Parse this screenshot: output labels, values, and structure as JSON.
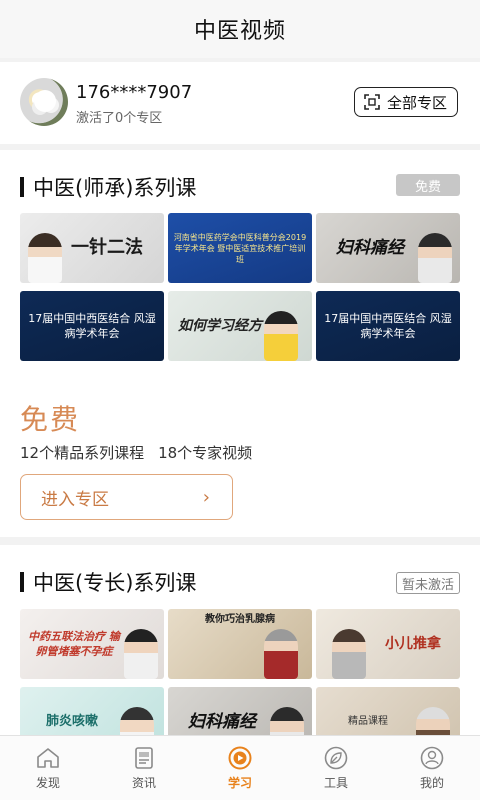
{
  "header": {
    "title": "中医视频"
  },
  "user": {
    "phone": "176****7907",
    "activated_text": "激活了0个专区",
    "all_zones_label": "全部专区"
  },
  "section1": {
    "title": "中医(师承)系列课",
    "badge": "免费",
    "thumbnails": [
      {
        "caption": "一针二法",
        "style": "t-light"
      },
      {
        "caption": "河南省中医药学会中医科普分会2019年学术年会 暨中医适宜技术推广培训班",
        "style": "t-blue"
      },
      {
        "caption": "妇科痛经",
        "style": "t-grey"
      },
      {
        "caption": "17届中国中西医结合 风湿病学术年会",
        "style": "t-navy"
      },
      {
        "caption": "如何学习经方",
        "style": "t-pale"
      },
      {
        "caption": "17届中国中西医结合 风湿病学术年会",
        "style": "t-navy"
      }
    ],
    "price_label": "免费",
    "course_count": "12个精品系列课程",
    "video_count": "18个专家视频",
    "enter_label": "进入专区"
  },
  "section2": {
    "title": "中医(专长)系列课",
    "badge": "暂未激活",
    "thumbnails": [
      {
        "caption": "中药五联法治疗 输卵管堵塞不孕症",
        "style": "t-white-red"
      },
      {
        "caption": "教你巧治乳腺病",
        "style": "t-beige"
      },
      {
        "caption": "小儿推拿",
        "style": "t-cream"
      },
      {
        "caption": "肺炎咳嗽",
        "style": "t-mint"
      },
      {
        "caption": "妇科痛经",
        "style": "t-grey"
      },
      {
        "caption": "精品课程",
        "style": "t-sand"
      }
    ]
  },
  "tabbar": {
    "items": [
      {
        "label": "发现",
        "icon": "home-icon"
      },
      {
        "label": "资讯",
        "icon": "news-icon"
      },
      {
        "label": "学习",
        "icon": "play-icon",
        "active": true
      },
      {
        "label": "工具",
        "icon": "leaf-icon"
      },
      {
        "label": "我的",
        "icon": "profile-icon"
      }
    ]
  },
  "colors": {
    "accent": "#e8821c",
    "free_text": "#d78a55",
    "enter_border": "#e0a77c"
  }
}
